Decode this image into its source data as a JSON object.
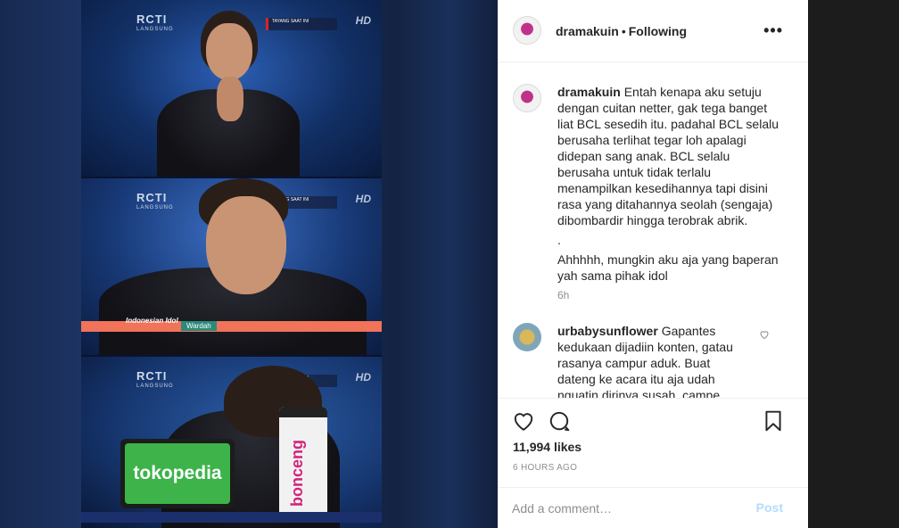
{
  "image": {
    "channel": "RCTI",
    "channel_sub": "LANGSUNG",
    "hd_badge": "HD",
    "tayang": "TAYANG SAAT INI",
    "idol_logo": "Indonesian Idol",
    "wardah": "Wardah",
    "tokopedia": "tokopedia",
    "bonceng": "bonceng"
  },
  "header": {
    "username": "dramakuin",
    "separator": "•",
    "follow_status": "Following",
    "more": "•••"
  },
  "caption": {
    "username": "dramakuin",
    "text": "Entah kenapa aku setuju dengan cuitan netter, gak tega banget liat BCL sesedih itu. padahal BCL selalu berusaha terlihat tegar loh apalagi didepan sang anak. BCL selalu berusaha untuk tidak terlalu menampilkan kesedihannya tapi disini rasa yang ditahannya seolah (sengaja) dibombardir hingga terobrak abrik.",
    "dot": ".",
    "text2": "Ahhhhh, mungkin aku aja yang baperan yah sama pihak idol",
    "time": "6h"
  },
  "comment": {
    "username": "urbabysunflower",
    "text": "Gapantes kedukaan dijadiin konten, gatau rasanya campur aduk. Buat dateng ke acara itu aja udah nguatin dirinya susah, campe"
  },
  "actions": {
    "likes": "11,994 likes",
    "time_ago": "6 HOURS AGO"
  },
  "add_comment": {
    "placeholder": "Add a comment…",
    "post_label": "Post"
  },
  "colors": {
    "post_button": "#b3dbff",
    "muted_text": "#8e8e8e",
    "primary_text": "#262626"
  }
}
